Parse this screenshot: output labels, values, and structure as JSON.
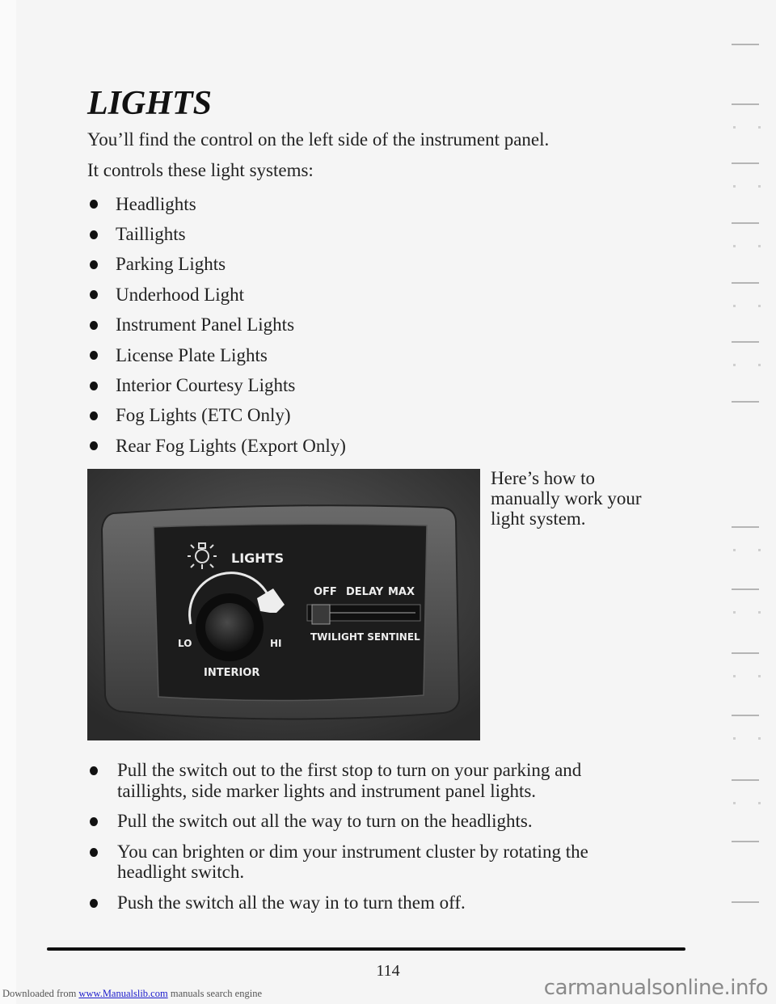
{
  "page": {
    "title": "LIGHTS",
    "intro_lines": [
      "You’ll find the control on the left side of the instrument panel.",
      "It controls these light systems:"
    ],
    "light_systems": [
      "Headlights",
      "Taillights",
      "Parking Lights",
      "Underhood Light",
      "Instrument Panel Lights",
      "License Plate Lights",
      "Interior Courtesy Lights",
      "Fog Lights (ETC Only)",
      "Rear Fog Lights (Export Only)"
    ],
    "figure": {
      "description": "Headlight control panel photo",
      "labels": {
        "lights": "LIGHTS",
        "lo": "LO",
        "hi": "HI",
        "interior": "INTERIOR",
        "off": "OFF",
        "delay": "DELAY",
        "max": "MAX",
        "twilight_sentinel": "TWILIGHT SENTINEL"
      },
      "icon": "headlamp-sun-icon"
    },
    "aside_text": "Here’s how to manually work your light system.",
    "steps": [
      "Pull the switch out to the first stop to turn on your parking and taillights, side marker lights and instrument panel lights.",
      "Pull the switch out all the way to turn on the headlights.",
      "You can brighten or dim your instrument cluster by rotating the headlight switch.",
      "Push the switch all the way in to turn them off."
    ],
    "page_number": "114"
  },
  "footer": {
    "downloaded_prefix": "Downloaded from ",
    "link_text": "www.Manualslib.com",
    "suffix": " manuals search engine",
    "watermark": "carmanualsonline.info"
  }
}
